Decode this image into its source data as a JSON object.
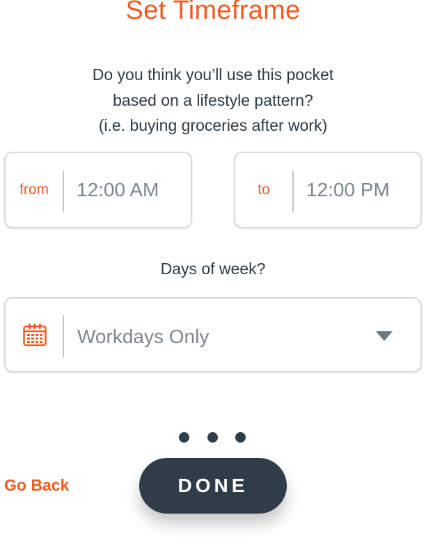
{
  "header": {
    "title": "Set Timeframe"
  },
  "question": {
    "lines": [
      "Do you think you’ll use this pocket",
      "based on a lifestyle pattern?",
      "(i.e. buying groceries after work)"
    ]
  },
  "timeframe": {
    "from": {
      "prefix": "from",
      "value": "12:00 AM"
    },
    "to": {
      "prefix": "to",
      "value": "12:00 PM"
    }
  },
  "days": {
    "label": "Days of week?",
    "selected": "Workdays Only",
    "icon": "calendar-icon",
    "dropdown_icon": "chevron-down-icon"
  },
  "pagination": {
    "count": 3
  },
  "footer": {
    "back_label": "Go Back",
    "done_label": "DONE"
  },
  "colors": {
    "accent": "#f15a22",
    "dark": "#2e3d49",
    "muted_text": "#7c8591",
    "border": "#d6d9dd"
  }
}
